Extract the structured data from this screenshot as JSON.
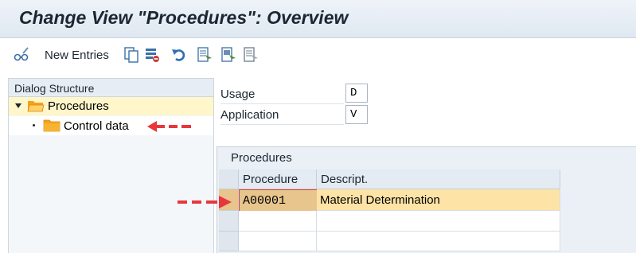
{
  "window": {
    "title": "Change View \"Procedures\": Overview"
  },
  "toolbar": {
    "new_entries_label": "New Entries",
    "icons": [
      "display-change-icon",
      "copy-icon",
      "delete-icon",
      "undo-icon",
      "select-all-icon",
      "select-block-icon",
      "deselect-all-icon"
    ]
  },
  "dialog_structure": {
    "header": "Dialog Structure",
    "items": [
      {
        "label": "Procedures",
        "expanded": true,
        "selected": true
      },
      {
        "label": "Control data",
        "expanded": false,
        "selected": false
      }
    ]
  },
  "fields": {
    "usage": {
      "label": "Usage",
      "value": "D"
    },
    "application": {
      "label": "Application",
      "value": "V"
    }
  },
  "procedures_table": {
    "title": "Procedures",
    "columns": [
      "Procedure",
      "Descript."
    ],
    "rows": [
      {
        "procedure": "A00001",
        "description": "Material Determination"
      }
    ]
  },
  "colors": {
    "selection_yellow": "#fff6c9",
    "row_highlight": "#fde3a6",
    "annotation_red": "#e8373a",
    "folder_orange": "#f5a21b"
  }
}
